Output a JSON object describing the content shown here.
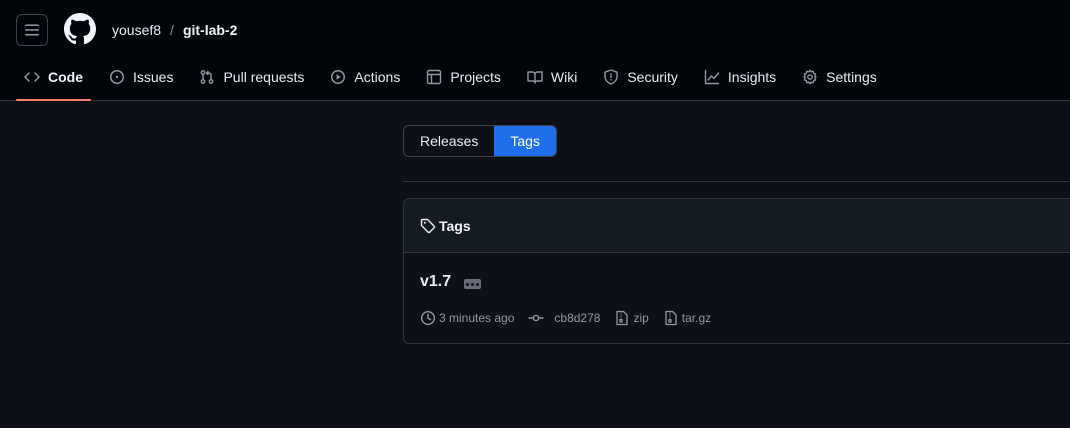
{
  "header": {
    "owner": "yousef8",
    "separator": "/",
    "repo": "git-lab-2"
  },
  "tabs": [
    {
      "label": "Code",
      "icon": "code-icon",
      "active": true
    },
    {
      "label": "Issues",
      "icon": "issue-opened-icon"
    },
    {
      "label": "Pull requests",
      "icon": "git-pull-request-icon"
    },
    {
      "label": "Actions",
      "icon": "play-icon"
    },
    {
      "label": "Projects",
      "icon": "table-icon"
    },
    {
      "label": "Wiki",
      "icon": "book-icon"
    },
    {
      "label": "Security",
      "icon": "shield-icon"
    },
    {
      "label": "Insights",
      "icon": "graph-icon"
    },
    {
      "label": "Settings",
      "icon": "gear-icon"
    }
  ],
  "subnav": {
    "releases": "Releases",
    "tags": "Tags",
    "selected": "Tags"
  },
  "tags_box": {
    "title": "Tags",
    "items": [
      {
        "name": "v1.7",
        "time": "3 minutes ago",
        "commit": "cb8d278",
        "zip": "zip",
        "targz": "tar.gz"
      }
    ]
  },
  "colors": {
    "background": "#0d1117",
    "header_bg": "#010409",
    "accent_underline": "#f78166",
    "selected_blue": "#1f6feb",
    "border": "#30363d",
    "muted_text": "#9198a1"
  }
}
